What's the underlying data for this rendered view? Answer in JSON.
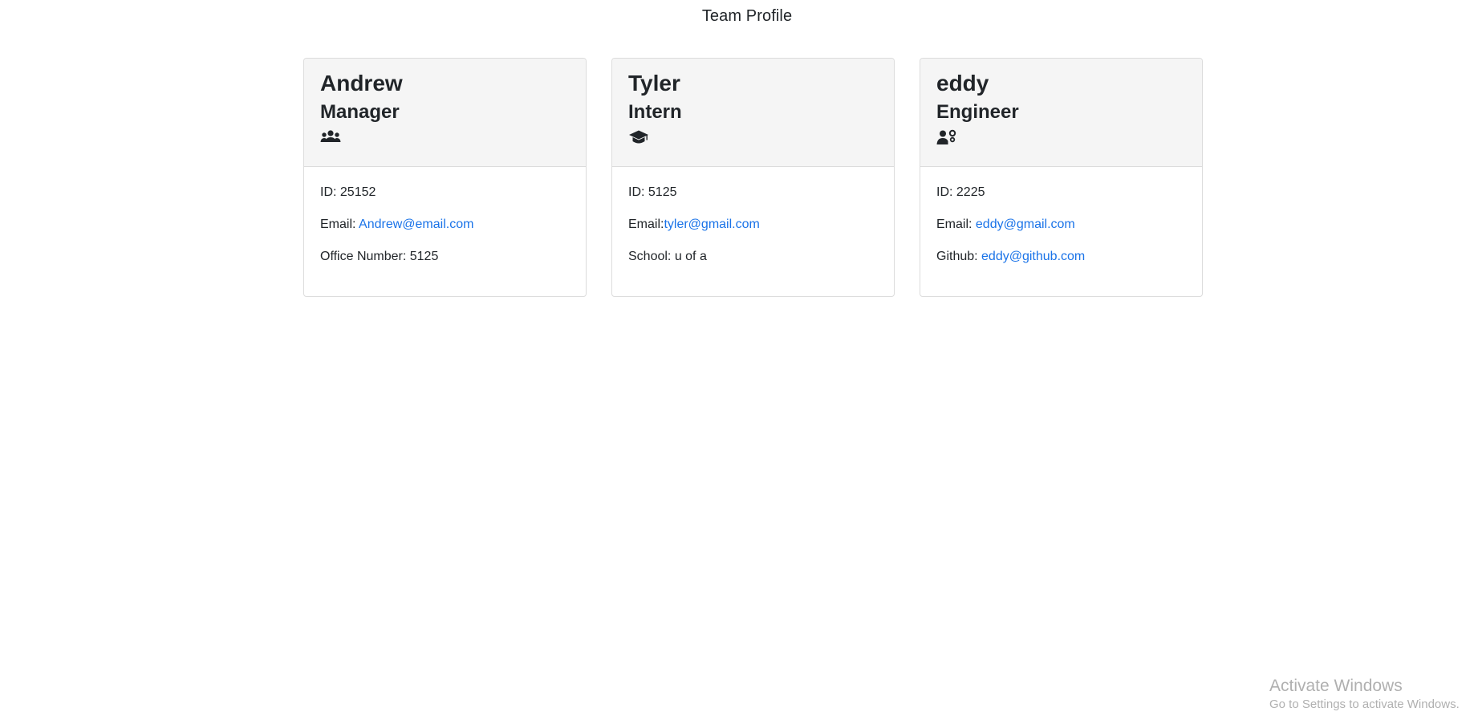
{
  "page": {
    "title": "Team Profile"
  },
  "cards": [
    {
      "name": "Andrew",
      "role": "Manager",
      "icon": "users-icon",
      "id_text": "ID: 25152",
      "email_label": "Email: ",
      "email": "Andrew@email.com",
      "extra_label": "Office Number: 5125",
      "extra_link": ""
    },
    {
      "name": "Tyler",
      "role": "Intern",
      "icon": "graduation-cap-icon",
      "id_text": "ID: 5125",
      "email_label": "Email:",
      "email": "tyler@gmail.com",
      "extra_label": "School: u of a",
      "extra_link": ""
    },
    {
      "name": "eddy",
      "role": "Engineer",
      "icon": "user-cog-icon",
      "id_text": "ID: 2225",
      "email_label": "Email: ",
      "email": "eddy@gmail.com",
      "extra_label": "Github: ",
      "extra_link": "eddy@github.com"
    }
  ],
  "watermark": {
    "title": "Activate Windows",
    "subtitle": "Go to Settings to activate Windows."
  },
  "colors": {
    "link": "#1a73e8",
    "header_bg": "#f5f5f5",
    "text": "#212529",
    "watermark": "#b0b0b0"
  }
}
